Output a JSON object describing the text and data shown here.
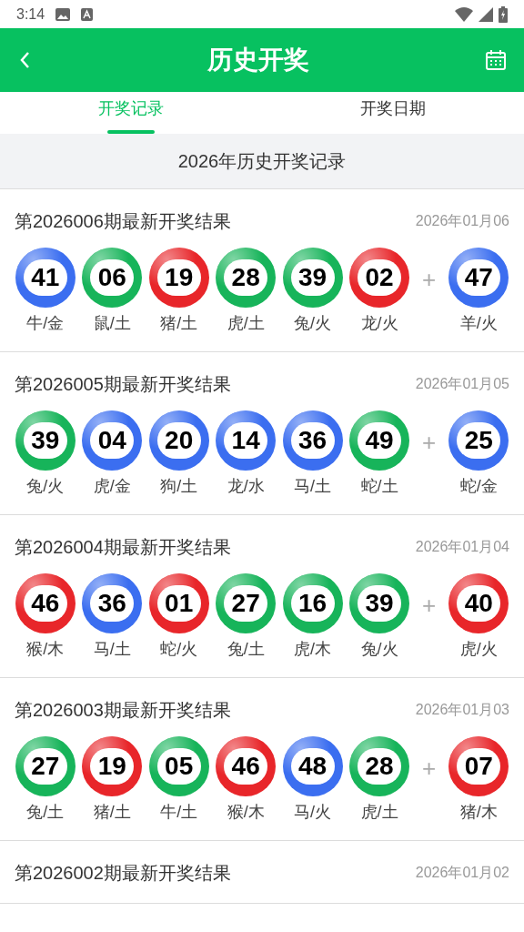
{
  "status_bar": {
    "time": "3:14"
  },
  "header": {
    "title": "历史开奖"
  },
  "tabs": [
    {
      "label": "开奖记录",
      "selected": true
    },
    {
      "label": "开奖日期",
      "selected": false
    }
  ],
  "section_title": "2026年历史开奖记录",
  "records": [
    {
      "title": "第2026006期最新开奖结果",
      "date": "2026年01月06",
      "plus": "+",
      "balls": [
        {
          "number": "41",
          "label": "牛/金",
          "color": "#3b6ef0"
        },
        {
          "number": "06",
          "label": "鼠/土",
          "color": "#17b45a"
        },
        {
          "number": "19",
          "label": "猪/土",
          "color": "#e8262a"
        },
        {
          "number": "28",
          "label": "虎/土",
          "color": "#17b45a"
        },
        {
          "number": "39",
          "label": "兔/火",
          "color": "#17b45a"
        },
        {
          "number": "02",
          "label": "龙/火",
          "color": "#e8262a"
        }
      ],
      "special": {
        "number": "47",
        "label": "羊/火",
        "color": "#3b6ef0"
      }
    },
    {
      "title": "第2026005期最新开奖结果",
      "date": "2026年01月05",
      "plus": "+",
      "balls": [
        {
          "number": "39",
          "label": "兔/火",
          "color": "#17b45a"
        },
        {
          "number": "04",
          "label": "虎/金",
          "color": "#3b6ef0"
        },
        {
          "number": "20",
          "label": "狗/土",
          "color": "#3b6ef0"
        },
        {
          "number": "14",
          "label": "龙/水",
          "color": "#3b6ef0"
        },
        {
          "number": "36",
          "label": "马/土",
          "color": "#3b6ef0"
        },
        {
          "number": "49",
          "label": "蛇/土",
          "color": "#17b45a"
        }
      ],
      "special": {
        "number": "25",
        "label": "蛇/金",
        "color": "#3b6ef0"
      }
    },
    {
      "title": "第2026004期最新开奖结果",
      "date": "2026年01月04",
      "plus": "+",
      "balls": [
        {
          "number": "46",
          "label": "猴/木",
          "color": "#e8262a"
        },
        {
          "number": "36",
          "label": "马/土",
          "color": "#3b6ef0"
        },
        {
          "number": "01",
          "label": "蛇/火",
          "color": "#e8262a"
        },
        {
          "number": "27",
          "label": "兔/土",
          "color": "#17b45a"
        },
        {
          "number": "16",
          "label": "虎/木",
          "color": "#17b45a"
        },
        {
          "number": "39",
          "label": "兔/火",
          "color": "#17b45a"
        }
      ],
      "special": {
        "number": "40",
        "label": "虎/火",
        "color": "#e8262a"
      }
    },
    {
      "title": "第2026003期最新开奖结果",
      "date": "2026年01月03",
      "plus": "+",
      "balls": [
        {
          "number": "27",
          "label": "兔/土",
          "color": "#17b45a"
        },
        {
          "number": "19",
          "label": "猪/土",
          "color": "#e8262a"
        },
        {
          "number": "05",
          "label": "牛/土",
          "color": "#17b45a"
        },
        {
          "number": "46",
          "label": "猴/木",
          "color": "#e8262a"
        },
        {
          "number": "48",
          "label": "马/火",
          "color": "#3b6ef0"
        },
        {
          "number": "28",
          "label": "虎/土",
          "color": "#17b45a"
        }
      ],
      "special": {
        "number": "07",
        "label": "猪/木",
        "color": "#e8262a"
      }
    },
    {
      "title": "第2026002期最新开奖结果",
      "date": "2026年01月02"
    }
  ]
}
